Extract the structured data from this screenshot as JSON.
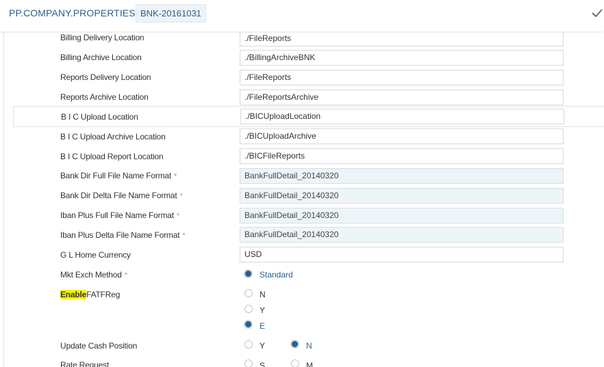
{
  "header": {
    "title": "PP.COMPANY.PROPERTIES",
    "record_id": "BNK-20161031",
    "commit_icon": "checkmark-icon"
  },
  "text_fields": [
    {
      "label": "Billing Delivery Location",
      "value": "./FileReports",
      "required": false,
      "readonly": false
    },
    {
      "label": "Billing Archive Location",
      "value": "./BillingArchiveBNK",
      "required": false,
      "readonly": false
    },
    {
      "label": "Reports Delivery Location",
      "value": "./FileReports",
      "required": false,
      "readonly": false
    },
    {
      "label": "Reports Archive Location",
      "value": "./FileReportsArchive",
      "required": false,
      "readonly": false
    },
    {
      "label": "B I C Upload Location",
      "value": "./BICUploadLocation",
      "required": false,
      "readonly": false
    },
    {
      "label": "B I C Upload Archive Location",
      "value": "./BICUploadArchive",
      "required": false,
      "readonly": false
    },
    {
      "label": "B I C Upload Report Location",
      "value": "./BICFileReports",
      "required": false,
      "readonly": false
    },
    {
      "label": "Bank Dir Full File Name Format",
      "value": "BankFullDetail_20140320",
      "required": true,
      "readonly": true
    },
    {
      "label": "Bank Dir Delta File Name Format",
      "value": "BankFullDetail_20140320",
      "required": true,
      "readonly": true
    },
    {
      "label": "Iban Plus Full File Name Format",
      "value": "BankFullDetail_20140320",
      "required": true,
      "readonly": true
    },
    {
      "label": "Iban Plus Delta File Name Format",
      "value": "BankFullDetail_20140320",
      "required": true,
      "readonly": true
    },
    {
      "label": "G L Home Currency",
      "value": "USD",
      "required": false,
      "readonly": false
    }
  ],
  "required_marker": "*",
  "mkt_exch_method": {
    "label": "Mkt Exch Method",
    "required": true,
    "option": "Standard",
    "selected": true
  },
  "enable_fatf_reg": {
    "label_highlight": "Enable",
    "label_rest": "FATFReg",
    "options": [
      "N",
      "Y",
      "E"
    ],
    "selected": "E"
  },
  "update_cash_position": {
    "label": "Update Cash Position",
    "options": [
      "Y",
      "N"
    ],
    "selected": "N"
  },
  "rate_request": {
    "label": "Rate Request",
    "options": [
      "S",
      "M"
    ],
    "selected": null
  }
}
